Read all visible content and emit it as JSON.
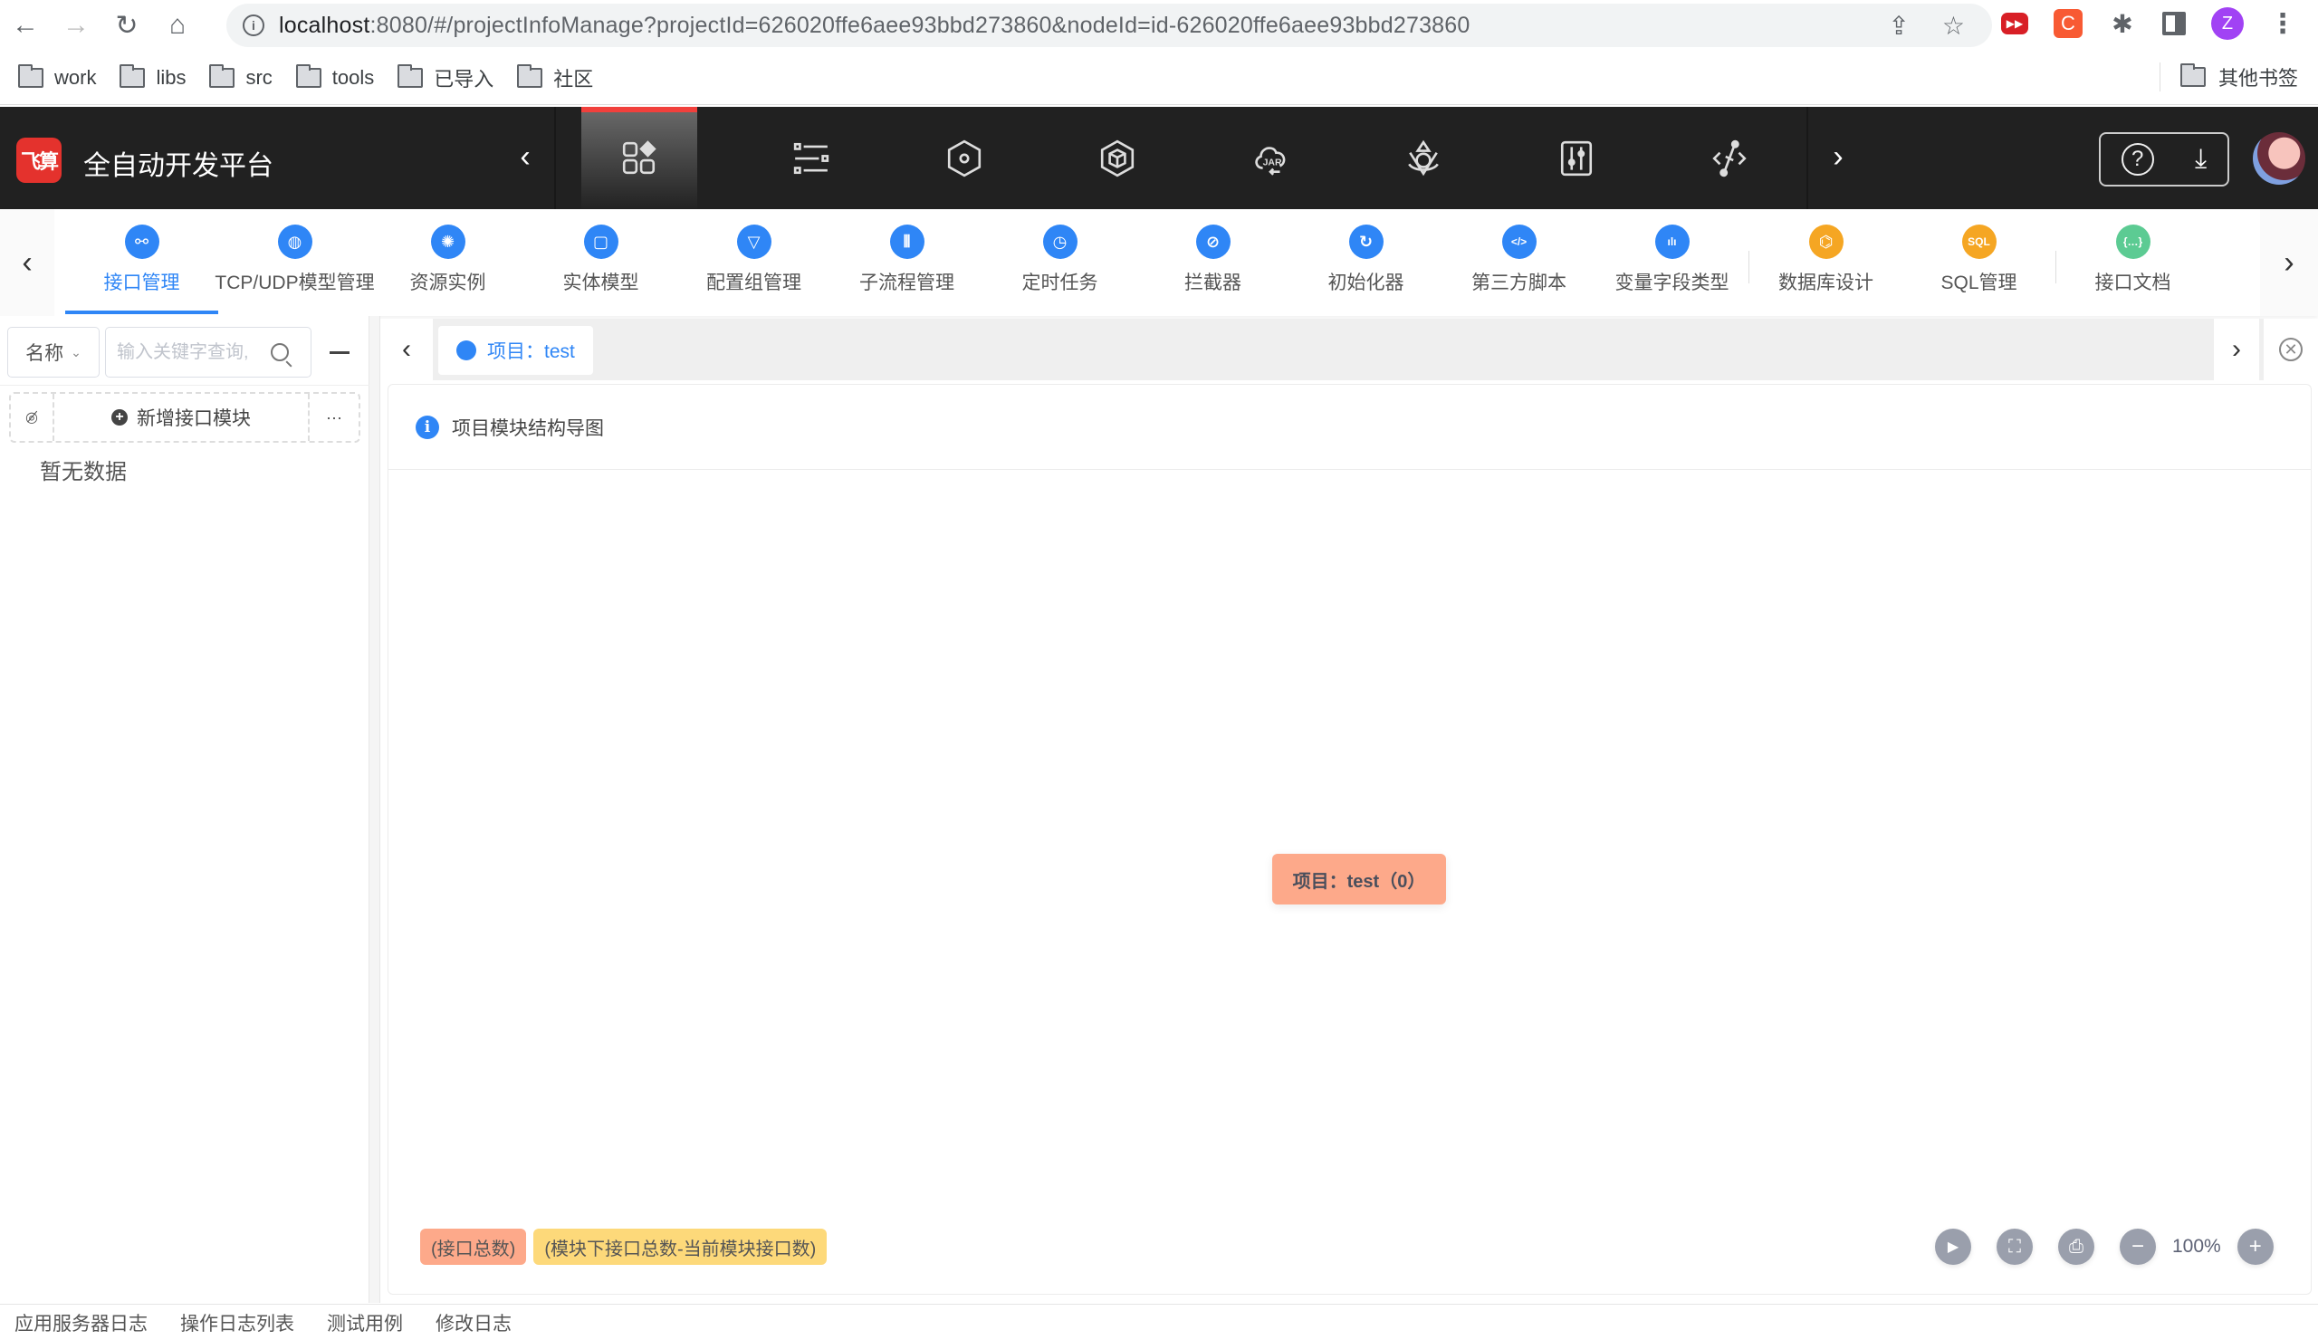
{
  "browser": {
    "url_host": "localhost",
    "url_rest": ":8080/#/projectInfoManage?projectId=626020ffe6aee93bbd273860&nodeId=id-626020ffe6aee93bbd273860",
    "profile_initial": "Z",
    "bookmarks": [
      "work",
      "libs",
      "src",
      "tools",
      "已导入",
      "社区"
    ],
    "other_bookmarks": "其他书签"
  },
  "header": {
    "logo_text": "飞算",
    "title": "全自动开发平台",
    "nav_icons": [
      "apps-icon",
      "list-settings-icon",
      "hexagon-icon",
      "cube-icon",
      "jar-cloud-icon",
      "network-icon",
      "sliders-icon",
      "api-link-icon"
    ],
    "active_index": 0
  },
  "modules": {
    "items": [
      {
        "label": "接口管理",
        "icon": "link-icon",
        "glyph": "⚯",
        "color": "blue",
        "active": true
      },
      {
        "label": "TCP/UDP模型管理",
        "icon": "globe-icon",
        "glyph": "◍",
        "color": "blue"
      },
      {
        "label": "资源实例",
        "icon": "atom-icon",
        "glyph": "✺",
        "color": "blue"
      },
      {
        "label": "实体模型",
        "icon": "frame-icon",
        "glyph": "▢",
        "color": "blue"
      },
      {
        "label": "配置组管理",
        "icon": "funnel-icon",
        "glyph": "▽",
        "color": "blue"
      },
      {
        "label": "子流程管理",
        "icon": "waveform-icon",
        "glyph": "⫴",
        "color": "blue"
      },
      {
        "label": "定时任务",
        "icon": "alarm-clock-icon",
        "glyph": "◷",
        "color": "blue"
      },
      {
        "label": "拦截器",
        "icon": "block-icon",
        "glyph": "⊘",
        "color": "blue"
      },
      {
        "label": "初始化器",
        "icon": "refresh-icon",
        "glyph": "↻",
        "color": "blue"
      },
      {
        "label": "第三方脚本",
        "icon": "code-icon",
        "glyph": "</>",
        "color": "blue"
      },
      {
        "label": "变量字段类型",
        "icon": "bar-chart-icon",
        "glyph": "ılı",
        "color": "blue"
      },
      {
        "label": "数据库设计",
        "icon": "database-icon",
        "glyph": "⌬",
        "color": "orange",
        "sep_before": true
      },
      {
        "label": "SQL管理",
        "icon": "sql-icon",
        "glyph": "SQL",
        "color": "orange"
      },
      {
        "label": "接口文档",
        "icon": "json-doc-icon",
        "glyph": "{…}",
        "color": "green",
        "sep_before": true
      }
    ]
  },
  "left_panel": {
    "filter_select": "名称",
    "search_placeholder": "输入关键字查询,",
    "add_module_label": "新增接口模块",
    "more_label": "···",
    "empty_text": "暂无数据"
  },
  "tabs": {
    "items": [
      {
        "label": "项目：test"
      }
    ]
  },
  "mindmap": {
    "title": "项目模块结构导图",
    "root_label": "项目：test（0）",
    "legend": [
      "(接口总数)",
      "(模块下接口总数-当前模块接口数)"
    ],
    "zoom_level": "100%",
    "colors": {
      "root": "#fda98a",
      "module": "#fdd97a",
      "accent": "#2f86f6"
    }
  },
  "bottom_tabs": [
    "应用服务器日志",
    "操作日志列表",
    "测试用例",
    "修改日志"
  ]
}
